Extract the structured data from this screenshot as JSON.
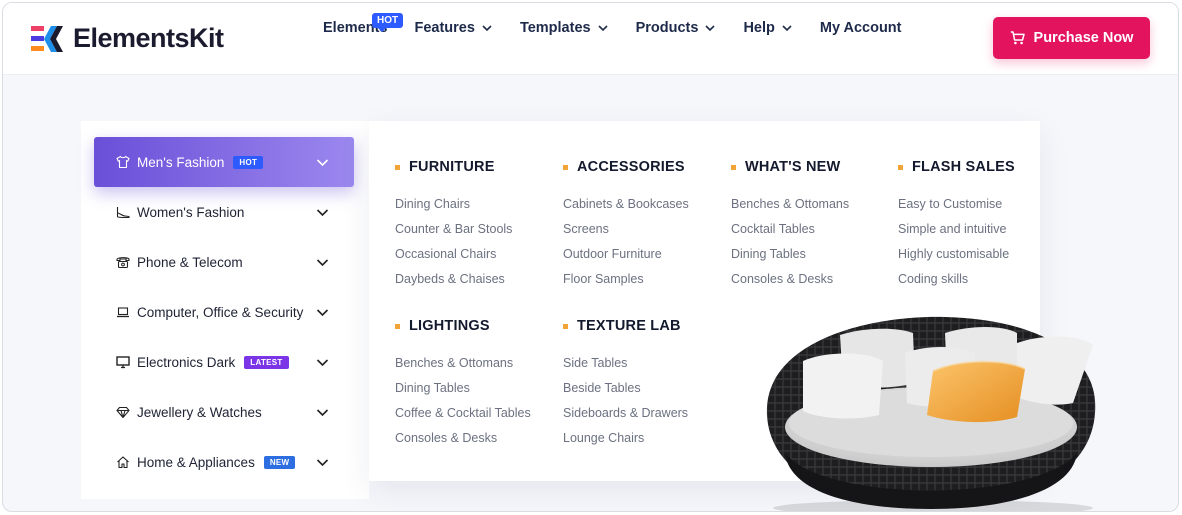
{
  "brand": {
    "name": "ElementsKit"
  },
  "nav": {
    "items": [
      {
        "label": "Elements",
        "badge": "HOT",
        "chevron": false
      },
      {
        "label": "Features",
        "chevron": true
      },
      {
        "label": "Templates",
        "chevron": true
      },
      {
        "label": "Products",
        "chevron": true
      },
      {
        "label": "Help",
        "chevron": true
      },
      {
        "label": "My Account",
        "chevron": false
      }
    ],
    "cta_label": "Purchase Now",
    "cta_icon": "cart-icon"
  },
  "colors": {
    "cta": "#e3135e",
    "active_item_start": "#6a4fd8",
    "active_item_end": "#9b88ee",
    "hot_badge": "#2d5bff",
    "latest_badge": "#7b35e6",
    "new_badge": "#2d6fe0",
    "column_bullet": "#f2a43a"
  },
  "sidebar": {
    "items": [
      {
        "label": "Men's Fashion",
        "icon": "tshirt-icon",
        "badge": "HOT",
        "active": true
      },
      {
        "label": "Women's Fashion",
        "icon": "heel-shoe-icon"
      },
      {
        "label": "Phone & Telecom",
        "icon": "telephone-icon"
      },
      {
        "label": "Computer, Office & Security",
        "icon": "laptop-icon"
      },
      {
        "label": "Electronics Dark",
        "icon": "monitor-icon",
        "badge": "LATEST"
      },
      {
        "label": "Jewellery & Watches",
        "icon": "diamond-icon"
      },
      {
        "label": "Home & Appliances",
        "icon": "home-icon",
        "badge": "NEW"
      }
    ]
  },
  "mega": {
    "columns": [
      {
        "title": "FURNITURE",
        "links": [
          "Dining Chairs",
          "Counter & Bar Stools",
          "Occasional Chairs",
          "Daybeds & Chaises"
        ]
      },
      {
        "title": "ACCESSORIES",
        "links": [
          "Cabinets & Bookcases",
          "Screens",
          "Outdoor Furniture",
          "Floor Samples"
        ]
      },
      {
        "title": "WHAT'S NEW",
        "links": [
          "Benches & Ottomans",
          "Cocktail Tables",
          "Dining Tables",
          "Consoles & Desks"
        ]
      },
      {
        "title": "FLASH SALES",
        "links": [
          "Easy to Customise",
          "Simple and intuitive",
          "Highly customisable",
          "Coding skills"
        ]
      },
      {
        "title": "LIGHTINGS",
        "links": [
          "Benches & Ottomans",
          "Dining Tables",
          "Coffee & Cocktail Tables",
          "Consoles & Desks"
        ]
      },
      {
        "title": "TEXTURE LAB",
        "links": [
          "Side Tables",
          "Beside Tables",
          "Sideboards & Drawers",
          "Lounge Chairs"
        ]
      }
    ],
    "image": "round-daybed-image"
  }
}
